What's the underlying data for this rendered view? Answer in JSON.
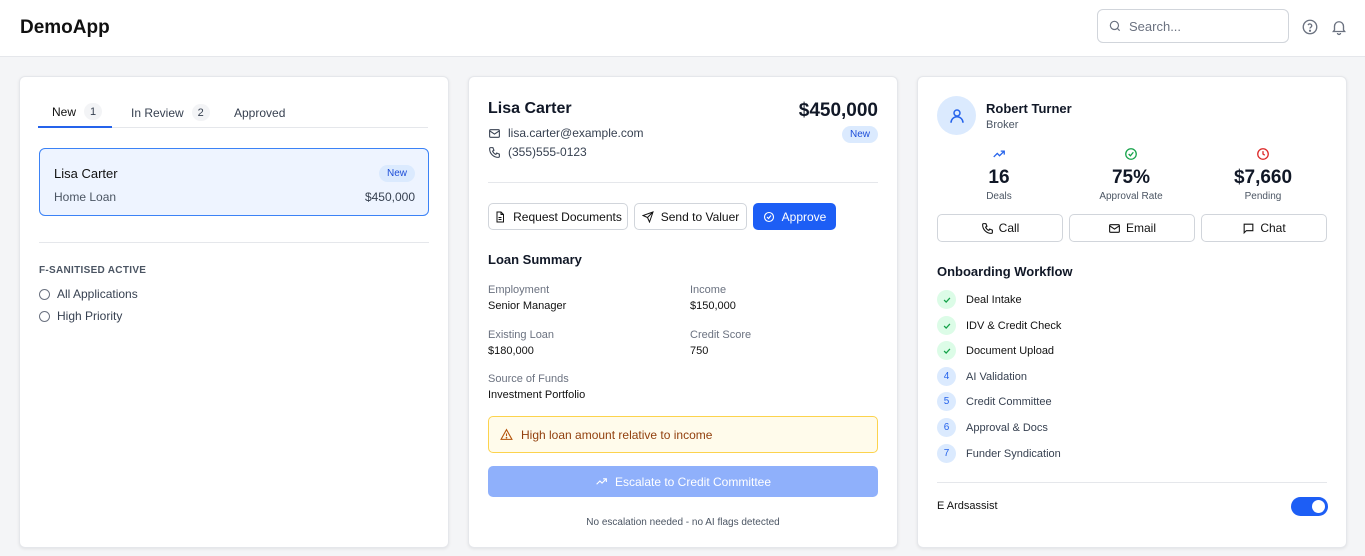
{
  "header": {
    "brand": "DemoApp",
    "search_placeholder": "Search..."
  },
  "queue": {
    "tabs": [
      {
        "label": "New",
        "count": "1"
      },
      {
        "label": "In Review",
        "count": "2"
      },
      {
        "label": "Approved"
      }
    ],
    "selected_application": {
      "name": "Lisa Carter",
      "badge": "New",
      "loan_type": "Home Loan",
      "amount": "$450,000"
    },
    "filter": {
      "title": "F-SANITISED ACTIVE",
      "options": [
        "All Applications",
        "High Priority"
      ]
    }
  },
  "applicant": {
    "name": "Lisa Carter",
    "amount": "$450,000",
    "badge": "New",
    "email": "lisa.carter@example.com",
    "phone": "(355)555-0123",
    "actions": {
      "request_documents": "Request Documents",
      "send_to_valuer": "Send to Valuer",
      "approve": "Approve"
    },
    "summary_title": "Loan Summary",
    "fields": {
      "employment": {
        "label": "Employment",
        "value": "Senior Manager"
      },
      "income": {
        "label": "Income",
        "value": "$150,000"
      },
      "existing_loan": {
        "label": "Existing Loan",
        "value": "$180,000"
      },
      "credit_score": {
        "label": "Credit Score",
        "value": "750"
      },
      "source_of_funds": {
        "label": "Source of Funds",
        "value": "Investment Portfolio"
      }
    },
    "warning": "High loan amount relative to income",
    "escalate_label": "Escalate to Credit Committee",
    "note": "No escalation needed - no AI flags detected"
  },
  "broker": {
    "name": "Robert Turner",
    "role": "Broker",
    "stats": [
      {
        "value": "16",
        "caption": "Deals",
        "icon": "trending-up-icon",
        "color": "#2563eb"
      },
      {
        "value": "75%",
        "caption": "Approval Rate",
        "icon": "check-circle-icon",
        "color": "#16a34a"
      },
      {
        "value": "$7,660",
        "caption": "Pending",
        "icon": "clock-icon",
        "color": "#dc2626"
      }
    ],
    "contact": {
      "call": "Call",
      "email": "Email",
      "chat": "Chat"
    },
    "workflow_title": "Onboarding Workflow",
    "workflow": [
      {
        "label": "Deal Intake",
        "status": "done"
      },
      {
        "label": "IDV & Credit Check",
        "status": "done"
      },
      {
        "label": "Document Upload",
        "status": "done"
      },
      {
        "label": "AI Validation",
        "status": "pending",
        "num": "4"
      },
      {
        "label": "Credit Committee",
        "status": "pending",
        "num": "5"
      },
      {
        "label": "Approval & Docs",
        "status": "pending",
        "num": "6"
      },
      {
        "label": "Funder Syndication",
        "status": "pending",
        "num": "7"
      }
    ],
    "toggle": {
      "label": "E Ardsassist",
      "on": true
    }
  },
  "colors": {
    "accent": "#1d5ef5",
    "success": "#16a34a",
    "danger": "#dc2626",
    "warning_bg": "#fffbeb"
  }
}
